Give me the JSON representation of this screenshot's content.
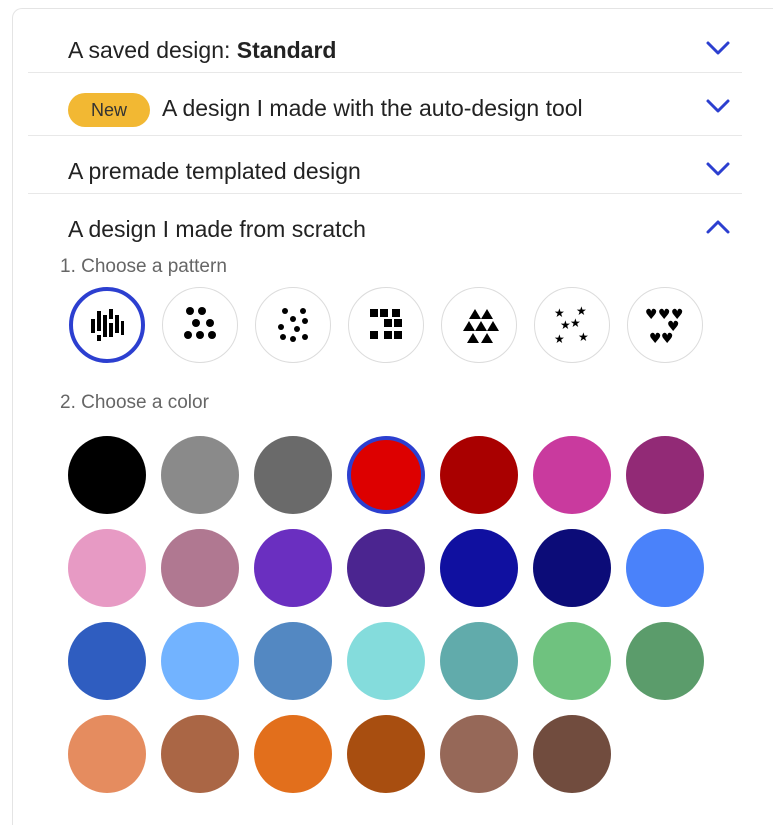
{
  "sections": {
    "saved": {
      "label_prefix": "A saved design: ",
      "label_strong": "Standard",
      "expanded": false
    },
    "auto": {
      "badge": "New",
      "label": "A design I made with the auto-design tool",
      "expanded": false
    },
    "premade": {
      "label": "A premade templated design",
      "expanded": false
    },
    "scratch": {
      "label": "A design I made from scratch",
      "expanded": true
    }
  },
  "steps": {
    "pattern": "1. Choose a pattern",
    "color": "2. Choose a color"
  },
  "patterns": [
    {
      "icon": "vertical-bars-pattern-icon",
      "selected": true
    },
    {
      "icon": "dots-pattern-icon",
      "selected": false
    },
    {
      "icon": "diamond-dots-pattern-icon",
      "selected": false
    },
    {
      "icon": "squares-pattern-icon",
      "selected": false
    },
    {
      "icon": "triangles-pattern-icon",
      "selected": false
    },
    {
      "icon": "stars-pattern-icon",
      "selected": false
    },
    {
      "icon": "hearts-pattern-icon",
      "selected": false
    }
  ],
  "colors": [
    "#000000",
    "#8a8a8a",
    "#6a6a6a",
    "#dd0000",
    "#a90000",
    "#c93a9e",
    "#922a76",
    "#e79ac4",
    "#b07891",
    "#6a2fc0",
    "#4b2590",
    "#1010a0",
    "#0c0c78",
    "#4a82fa",
    "#2f5dc0",
    "#72b3ff",
    "#5388c2",
    "#84dcdc",
    "#61abab",
    "#6fc27f",
    "#5b9c6b",
    "#e58c5f",
    "#aa6645",
    "#e26f1c",
    "#a84e10",
    "#966858",
    "#714c3e"
  ],
  "selected_color_index": 3,
  "accent_color": "#2c3fd0",
  "badge_color": "#f2b833"
}
